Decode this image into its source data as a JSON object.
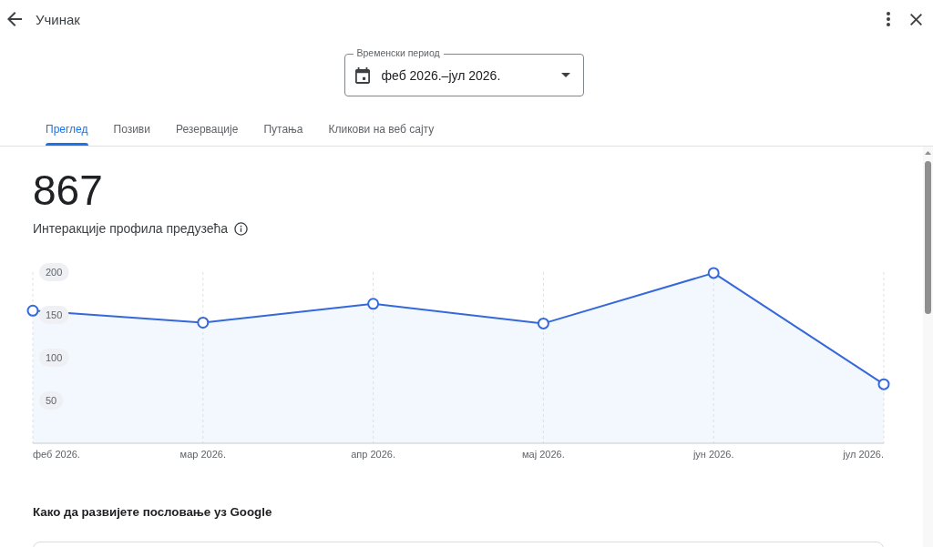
{
  "header": {
    "title": "Учинак"
  },
  "date_range": {
    "label": "Временски период",
    "value": "феб 2026.–јул 2026."
  },
  "tabs": [
    {
      "label": "Преглед",
      "selected": true
    },
    {
      "label": "Позиви",
      "selected": false
    },
    {
      "label": "Резервације",
      "selected": false
    },
    {
      "label": "Путања",
      "selected": false
    },
    {
      "label": "Кликови на веб сајту",
      "selected": false
    }
  ],
  "overview": {
    "total": "867",
    "label": "Интеракције профила предузећа",
    "chart_data": {
      "type": "area",
      "grid": true,
      "categories": [
        "феб 2026.",
        "мар 2026.",
        "апр 2026.",
        "мај 2026.",
        "јун 2026.",
        "јул 2026."
      ],
      "values": [
        155,
        141,
        163,
        140,
        199,
        69
      ],
      "ylim": [
        0,
        200
      ],
      "yticks": [
        50,
        100,
        150,
        200
      ]
    }
  },
  "growth_section": {
    "title": "Како да развијете пословање уз Google"
  }
}
